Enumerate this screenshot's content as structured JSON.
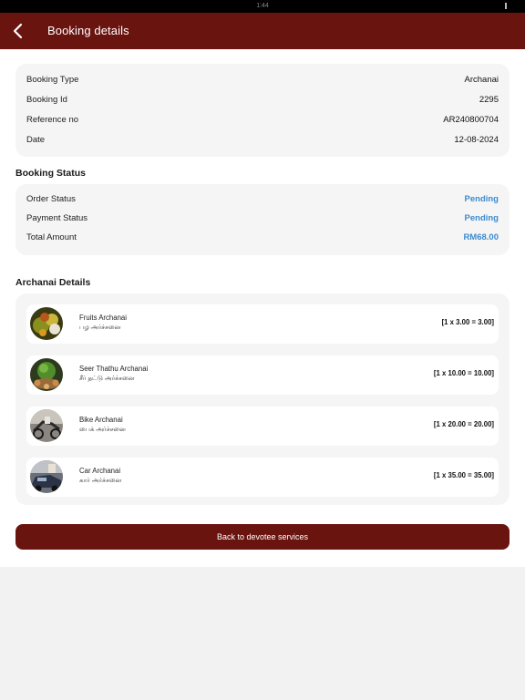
{
  "status_bar": {
    "time": "1:44"
  },
  "header": {
    "title": "Booking details"
  },
  "summary": {
    "rows": [
      {
        "label": "Booking Type",
        "value": "Archanai"
      },
      {
        "label": "Booking Id",
        "value": "2295"
      },
      {
        "label": "Reference no",
        "value": "AR240800704"
      },
      {
        "label": "Date",
        "value": "12-08-2024"
      }
    ]
  },
  "booking_status": {
    "title": "Booking Status",
    "accent_color": "#3d8bd0",
    "rows": [
      {
        "label": "Order Status",
        "value": "Pending"
      },
      {
        "label": "Payment Status",
        "value": "Pending"
      },
      {
        "label": "Total Amount",
        "value": "RM68.00"
      }
    ]
  },
  "archanai": {
    "title": "Archanai Details",
    "items": [
      {
        "name": "Fruits Archanai",
        "tamil": "பழ அர்ச்சனை",
        "price": "[1 x 3.00 = 3.00]",
        "icon": "fruits-image"
      },
      {
        "name": "Seer Thathu Archanai",
        "tamil": "சீர் தட்டு அர்ச்சனை",
        "price": "[1 x 10.00 = 10.00]",
        "icon": "seer-thathu-image"
      },
      {
        "name": "Bike Archanai",
        "tamil": "பைக் அர்ச்சனை",
        "price": "[1 x 20.00 = 20.00]",
        "icon": "bike-image"
      },
      {
        "name": "Car Archanai",
        "tamil": "கார் அர்ச்சனை",
        "price": "[1 x 35.00 = 35.00]",
        "icon": "car-image"
      }
    ]
  },
  "actions": {
    "back_label": "Back to devotee services"
  },
  "colors": {
    "brand": "#6a1410",
    "status": "#3d8bd0"
  }
}
